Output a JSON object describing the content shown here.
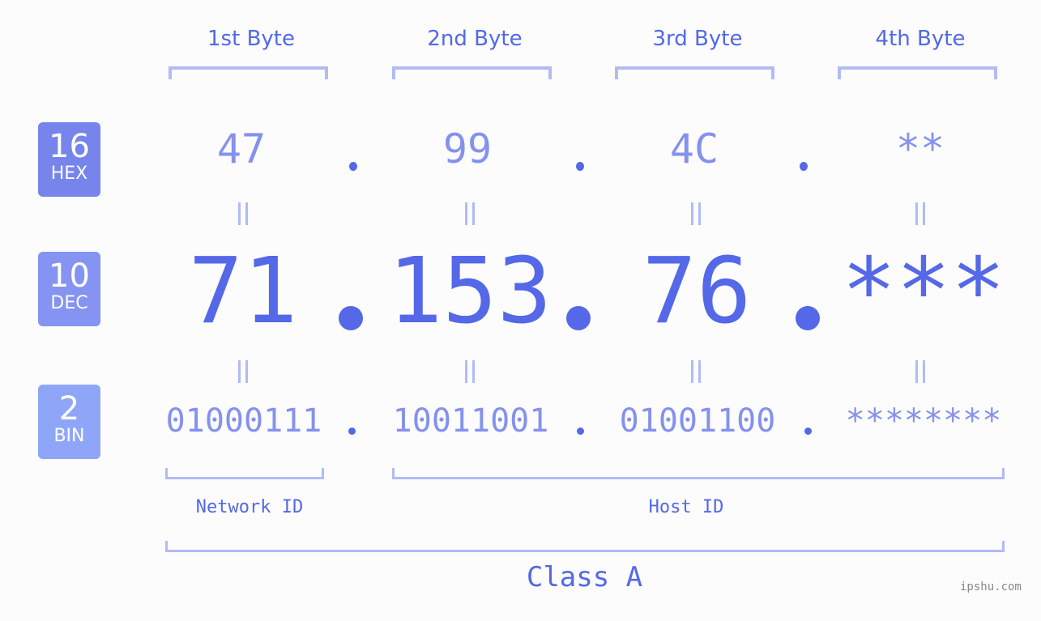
{
  "byte_headers": [
    "1st Byte",
    "2nd Byte",
    "3rd Byte",
    "4th Byte"
  ],
  "badges": {
    "hex": {
      "number": "16",
      "label": "HEX",
      "color": "#7684ec"
    },
    "dec": {
      "number": "10",
      "label": "DEC",
      "color": "#8593f2"
    },
    "bin": {
      "number": "2",
      "label": "BIN",
      "color": "#8fa6f8"
    }
  },
  "hex_values": [
    "47",
    "99",
    "4C",
    "**"
  ],
  "dec_values": [
    "71",
    "153",
    "76",
    "***"
  ],
  "bin_values": [
    "01000111",
    "10011001",
    "01001100",
    "********"
  ],
  "separator": ".",
  "network_label": "Network ID",
  "host_label": "Host ID",
  "class_label": "Class A",
  "watermark": "ipshu.com",
  "colors": {
    "primary": "#5468e8",
    "secondary": "#8591ee",
    "bracket": "#b1bbf6"
  }
}
